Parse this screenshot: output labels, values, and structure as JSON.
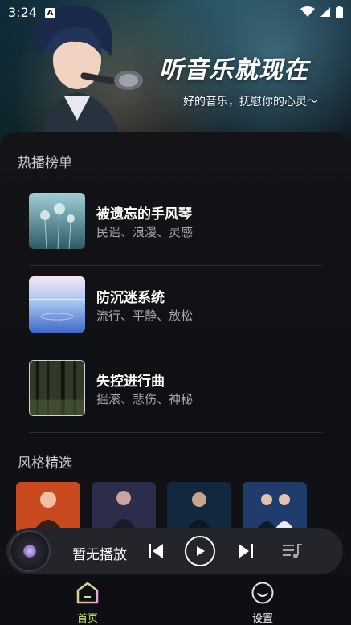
{
  "status_bar": {
    "time": "3:24",
    "badge": "A",
    "icons": [
      "wifi-icon",
      "signal-icon",
      "battery-icon"
    ]
  },
  "banner": {
    "title": "听音乐就现在",
    "subtitle": "好的音乐，抚慰你的心灵～"
  },
  "hot_section": {
    "title": "热播榜单",
    "items": [
      {
        "title": "被遗忘的手风琴",
        "tags": "民谣、浪漫、灵感"
      },
      {
        "title": "防沉迷系统",
        "tags": "流行、平静、放松"
      },
      {
        "title": "失控进行曲",
        "tags": "摇滚、悲伤、神秘"
      }
    ]
  },
  "style_section": {
    "title": "风格精选"
  },
  "player": {
    "status": "暂无播放",
    "icons": [
      "skip-previous-icon",
      "play-icon",
      "skip-next-icon",
      "playlist-icon"
    ]
  },
  "tabs": [
    {
      "label": "首页",
      "active": true,
      "color": "#c6f06a"
    },
    {
      "label": "设置",
      "active": false,
      "color": "#ffffff"
    }
  ],
  "colors": {
    "accent": "#c6f06a",
    "card_bg": "#141418",
    "player_bg": "#24252b"
  }
}
